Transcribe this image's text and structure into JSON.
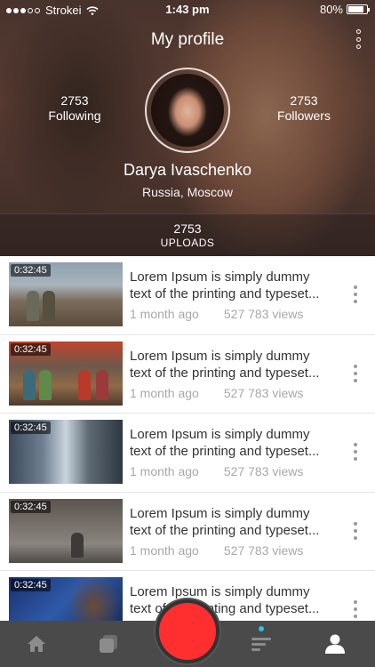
{
  "status_bar": {
    "carrier": "Strokei",
    "time": "1:43 pm",
    "battery": "80%",
    "signal_bars_filled": 3,
    "signal_bars_total": 5
  },
  "header": {
    "title": "My profile",
    "more_icon": "more-vertical-icon"
  },
  "profile": {
    "following_count": "2753",
    "following_label": "Following",
    "followers_count": "2753",
    "followers_label": "Followers",
    "name": "Darya Ivaschenko",
    "location": "Russia, Moscow",
    "uploads_count": "2753",
    "uploads_label": "UPLOADS"
  },
  "videos": [
    {
      "duration": "0:32:45",
      "title": "Lorem Ipsum is simply dummy text of the printing and typeset...",
      "age": "1 month ago",
      "views": "527 783 views"
    },
    {
      "duration": "0:32:45",
      "title": "Lorem Ipsum is simply dummy text of the printing and typeset...",
      "age": "1 month ago",
      "views": "527 783 views"
    },
    {
      "duration": "0:32:45",
      "title": "Lorem Ipsum is simply dummy text of the printing and typeset...",
      "age": "1 month ago",
      "views": "527 783 views"
    },
    {
      "duration": "0:32:45",
      "title": "Lorem Ipsum is simply dummy text of the printing and typeset...",
      "age": "1 month ago",
      "views": "527 783 views"
    },
    {
      "duration": "0:32:45",
      "title": "Lorem Ipsum is simply dummy text of the printing and typeset...",
      "age": "",
      "views": ""
    }
  ],
  "tab_bar": {
    "tabs": [
      "home-icon",
      "library-icon",
      "record-icon",
      "feed-icon",
      "profile-icon"
    ],
    "active": "profile-icon"
  },
  "colors": {
    "record": "#ff2f2f",
    "tab_bar_bg": "#4a4a4a",
    "feed_dot": "#27c5e7",
    "meta_text": "#a8a8a8"
  }
}
